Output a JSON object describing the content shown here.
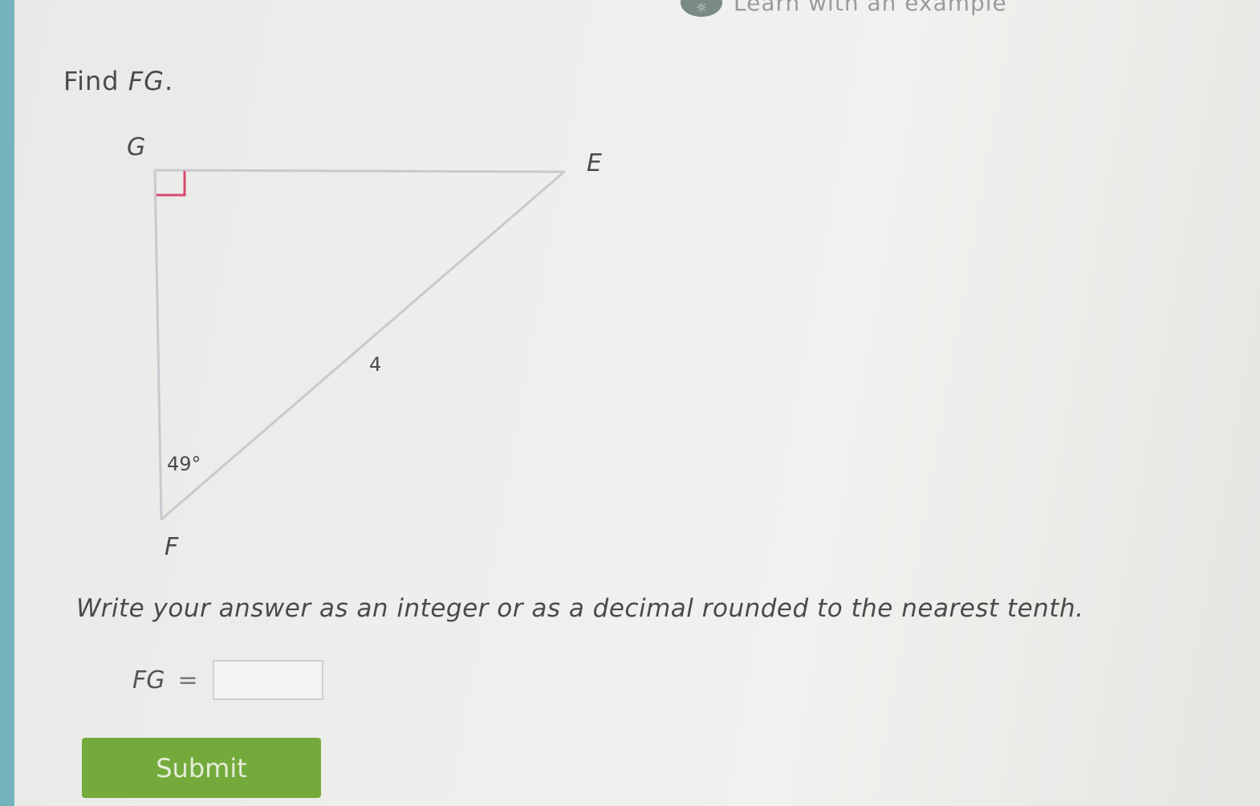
{
  "top_link": {
    "label": "Learn with an example",
    "icon": "lightbulb-icon"
  },
  "question": {
    "prefix": "Find ",
    "variable": "FG",
    "suffix": "."
  },
  "diagram": {
    "vertices": {
      "G": "G",
      "E": "E",
      "F": "F"
    },
    "side_label": "4",
    "angle_label": "49°",
    "right_angle_at": "G",
    "colors": {
      "triangle": "#c9c9cf",
      "right_angle_marker": "#d64b6e"
    }
  },
  "instruction": "Write your answer as an integer or as a decimal rounded to the nearest tenth.",
  "answer": {
    "label": "FG",
    "equals": "=",
    "value": ""
  },
  "submit": {
    "label": "Submit",
    "color": "#74aa3c"
  },
  "theme": {
    "rail_color": "#74b3bd"
  }
}
